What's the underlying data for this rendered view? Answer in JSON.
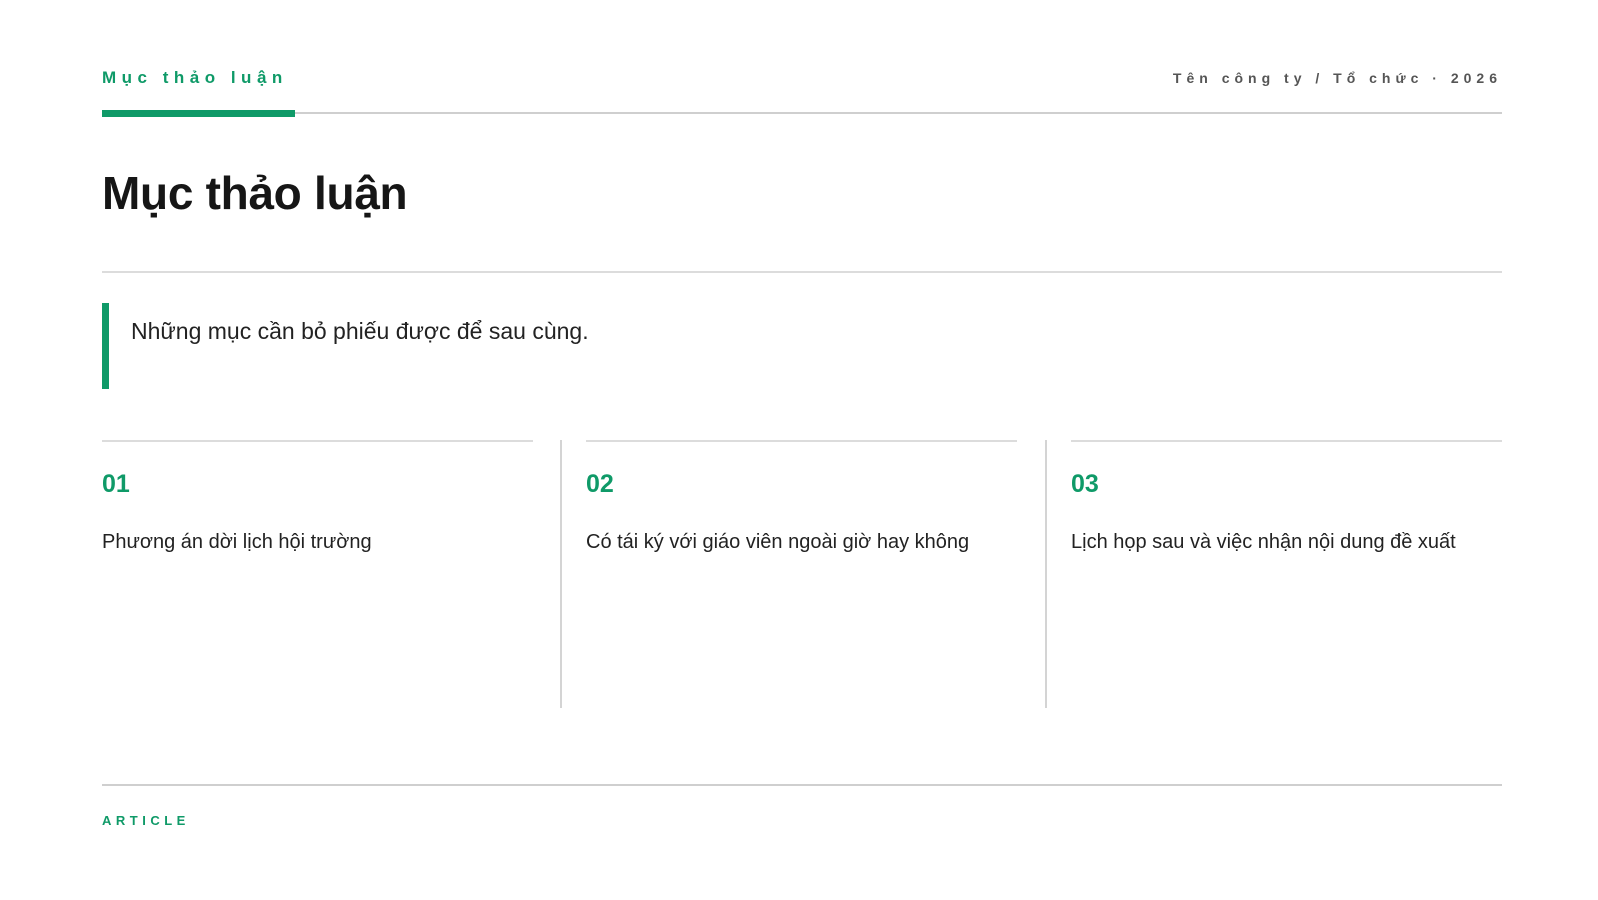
{
  "header": {
    "section_label": "Mục thảo luận",
    "org_label": "Tên công ty / Tổ chức · 2026"
  },
  "title": "Mục thảo luận",
  "callout": {
    "text": "Những mục cần bỏ phiếu được để sau cùng."
  },
  "items": [
    {
      "number": "01",
      "text": "Phương án dời lịch hội trường"
    },
    {
      "number": "02",
      "text": "Có tái ký với giáo viên ngoài giờ hay không"
    },
    {
      "number": "03",
      "text": "Lịch họp sau và việc nhận nội dung đề xuất"
    }
  ],
  "footer": {
    "label": "ARTICLE"
  },
  "colors": {
    "accent": "#0f9a68",
    "text": "#1f1f1f",
    "rule": "#d4d4d4"
  }
}
